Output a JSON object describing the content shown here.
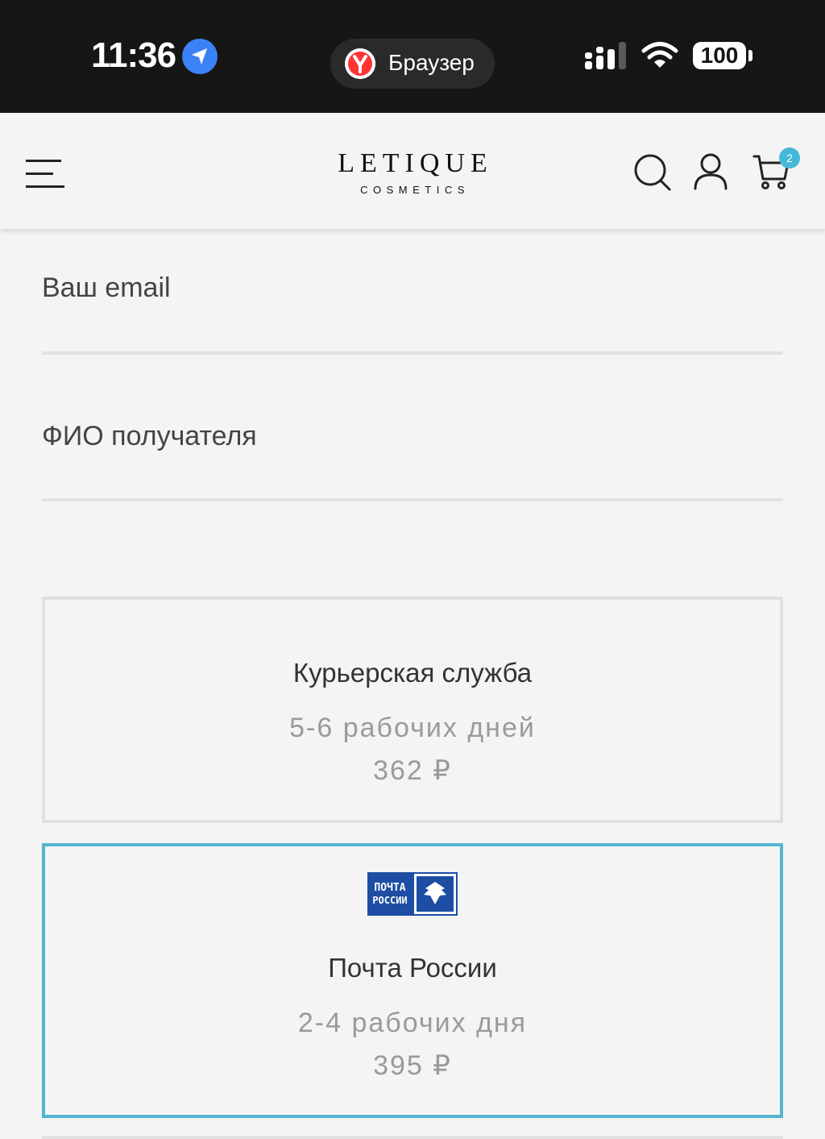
{
  "status_bar": {
    "time": "11:36",
    "app_pill_label": "Браузер",
    "battery": "100"
  },
  "header": {
    "brand_name": "LETIQUE",
    "brand_subtitle": "COSMETICS",
    "cart_count": "2"
  },
  "form": {
    "email_label": "Ваш email",
    "name_label": "ФИО получателя"
  },
  "delivery_options": [
    {
      "title": "Курьерская служба",
      "days": "5-6 рабочих дней",
      "price": "362 ₽",
      "selected": false
    },
    {
      "title": "Почта России",
      "days": "2-4 рабочих дня",
      "price": "395 ₽",
      "selected": true,
      "logo_text": [
        "ПОЧТА",
        "РОССИИ"
      ]
    }
  ],
  "colors": {
    "accent": "#52b6d1",
    "badge": "#44b8d8",
    "status_bar_bg": "#161616",
    "page_bg": "#f4f4f4",
    "post_logo_blue": "#1d4ea3"
  }
}
